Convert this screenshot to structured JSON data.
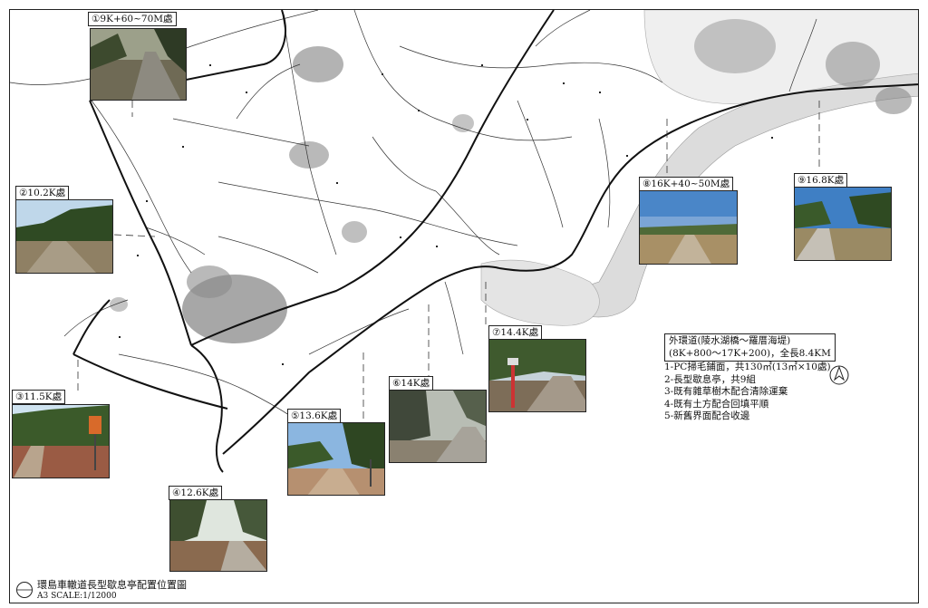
{
  "photos": [
    {
      "label": "①9K+60~70M處"
    },
    {
      "label": "②10.2K處"
    },
    {
      "label": "③11.5K處"
    },
    {
      "label": "④12.6K處"
    },
    {
      "label": "⑤13.6K處"
    },
    {
      "label": "⑥14K處"
    },
    {
      "label": "⑦14.4K處"
    },
    {
      "label": "⑧16K+40~50M處"
    },
    {
      "label": "⑨16.8K處"
    }
  ],
  "legend": {
    "heading": "外環道(陵水湖橋～羅厝海堤)",
    "range": "(8K+800～17K+200)，全長8.4KM",
    "items": [
      "1-PC掃毛鋪面，共130㎡(13㎡×10處)",
      "2-長型歇息亭，共9組",
      "3-既有雜草樹木配合清除運棄",
      "4-既有土方配合回填平順",
      "5-新舊界面配合收邊"
    ]
  },
  "drawing": {
    "title": "環島車轍道長型歇息亭配置位置圖",
    "scale": "A3 SCALE:1/12000"
  },
  "colors": {
    "line": "#1a1a1a",
    "built_area": "#8a8a8a",
    "sand": "#c9c9c9"
  }
}
